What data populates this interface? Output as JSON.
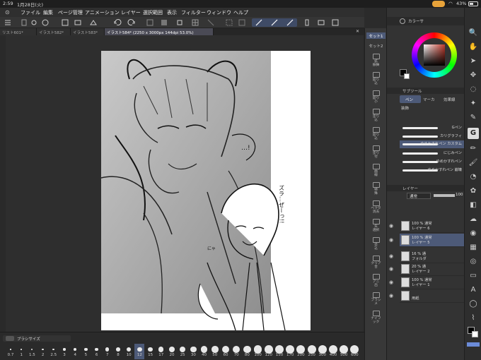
{
  "status_bar": {
    "time": "2:59",
    "date": "1月28日(火)",
    "battery": "43%"
  },
  "menu": {
    "items": [
      "ファイル",
      "編集",
      "ページ管理",
      "アニメーション",
      "レイヤー",
      "選択範囲",
      "表示",
      "フィルター",
      "ウィンドウ",
      "ヘルプ"
    ]
  },
  "tabs": [
    {
      "label": "リスト601*"
    },
    {
      "label": "イラスト582*"
    },
    {
      "label": "イラスト583*"
    },
    {
      "label": "イラスト584* (2250 x 3000px 144dpi 53.0%)"
    }
  ],
  "subtool_column": {
    "set1": "セット1",
    "set2": "セット2",
    "items": [
      "拡\n振舞",
      "鉛り\n込",
      "鉛り\n小",
      "塗り\n込",
      "鉛り\n込",
      "塗り\n付",
      "曲\n線",
      "特\n殊",
      "ベクタ\n消去",
      "矢\n選択",
      "塗\n込",
      "クリア\n合",
      "アニ\n出",
      "ブラシ\nメ",
      "ナイフ\nック"
    ]
  },
  "color_panel": {
    "title": "カラーサ",
    "accent": "#c0392b"
  },
  "subtool_panel": {
    "title": "サブツール",
    "tab_pen": "ペン",
    "tab_marker": "マーカ",
    "tab_effect": "効果線",
    "tab_decor": "装飾",
    "group_label": "ペン",
    "brushes": [
      "Gペン",
      "カリグラフィ",
      "ゆめかすれペン カスタム",
      "にじみペン",
      "ゆめかすれペン",
      "ゆめかすれペン 崩壊"
    ]
  },
  "layer_panel": {
    "title": "レイヤー",
    "blend_mode": "通常",
    "opacity": "100",
    "layers": [
      {
        "line1": "100 % 通常",
        "line2": "レイヤー 6",
        "selected": false
      },
      {
        "line1": "100 % 通常",
        "line2": "レイヤー 5",
        "selected": true
      },
      {
        "line1": "16 % 通",
        "line2": "フォルダ",
        "selected": false
      },
      {
        "line1": "20 % 通",
        "line2": "レイヤー 2",
        "selected": false
      },
      {
        "line1": "100 % 通常",
        "line2": "レイヤー 1",
        "selected": false
      },
      {
        "line1": "",
        "line2": "用紙",
        "selected": false
      }
    ]
  },
  "brush_size_bar": {
    "title": "ブラシサイズ",
    "sizes": [
      "0.7",
      "1",
      "1.5",
      "2",
      "2.5",
      "3",
      "4",
      "5",
      "6",
      "7",
      "8",
      "10",
      "12",
      "15",
      "17",
      "20",
      "25",
      "30",
      "40",
      "50",
      "60",
      "70",
      "80",
      "100",
      "120",
      "150",
      "170",
      "200",
      "250",
      "300",
      "400",
      "500",
      "600"
    ],
    "selected": "12"
  },
  "canvas_text": {
    "bubble": "…!",
    "vertical": "ズラ…ぜーっ!!",
    "small": "にゃ"
  }
}
